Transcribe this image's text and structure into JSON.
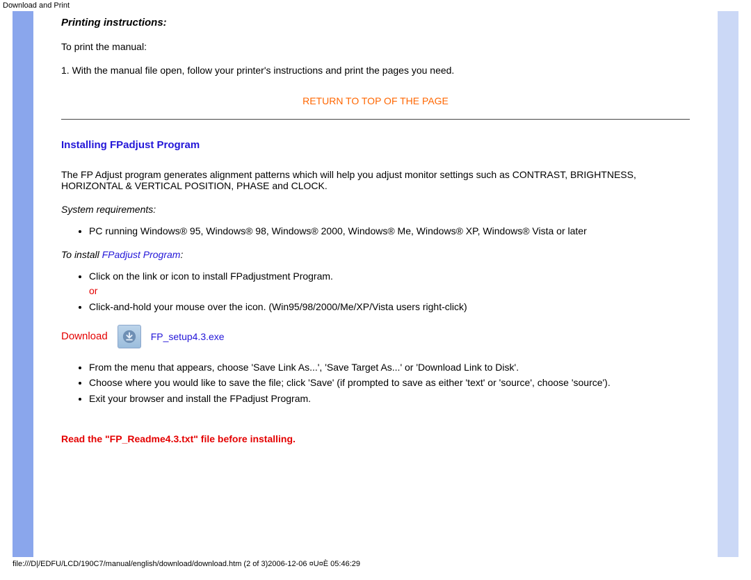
{
  "page_title": "Download and Print",
  "section_printing": {
    "heading": "Printing instructions:",
    "intro": "To print the manual:",
    "step1": "1. With the manual file open, follow your printer's instructions and print the pages you need."
  },
  "return_link": "RETURN TO TOP OF THE PAGE",
  "section_fpadjust": {
    "heading": "Installing FPadjust Program",
    "description": "The FP Adjust program generates alignment patterns which will help you adjust monitor settings such as CONTRAST, BRIGHTNESS, HORIZONTAL & VERTICAL POSITION, PHASE and CLOCK.",
    "sys_req_heading": "System requirements:",
    "sys_req_item": "PC running Windows® 95, Windows® 98, Windows® 2000, Windows® Me, Windows® XP, Windows® Vista or later",
    "install_heading_prefix": "To install ",
    "install_heading_link": "FPadjust Program",
    "install_heading_suffix": ":",
    "install_bullet_1": "Click on the link or icon to install FPadjustment Program.",
    "install_or": "or",
    "install_bullet_2": "Click-and-hold your mouse over the icon. (Win95/98/2000/Me/XP/Vista users right-click)"
  },
  "download": {
    "label": "Download",
    "filename": "FP_setup4.3.exe"
  },
  "save_steps": {
    "s1": "From the menu that appears, choose 'Save Link As...', 'Save Target As...' or 'Download Link to Disk'.",
    "s2": "Choose where you would like to save the file; click 'Save' (if prompted to save as either 'text' or 'source', choose 'source').",
    "s3": "Exit your browser and install the FPadjust Program."
  },
  "readme_note": "Read the \"FP_Readme4.3.txt\" file before installing.",
  "footer": "file:///D|/EDFU/LCD/190C7/manual/english/download/download.htm (2 of 3)2006-12-06 ¤U¤È 05:46:29"
}
